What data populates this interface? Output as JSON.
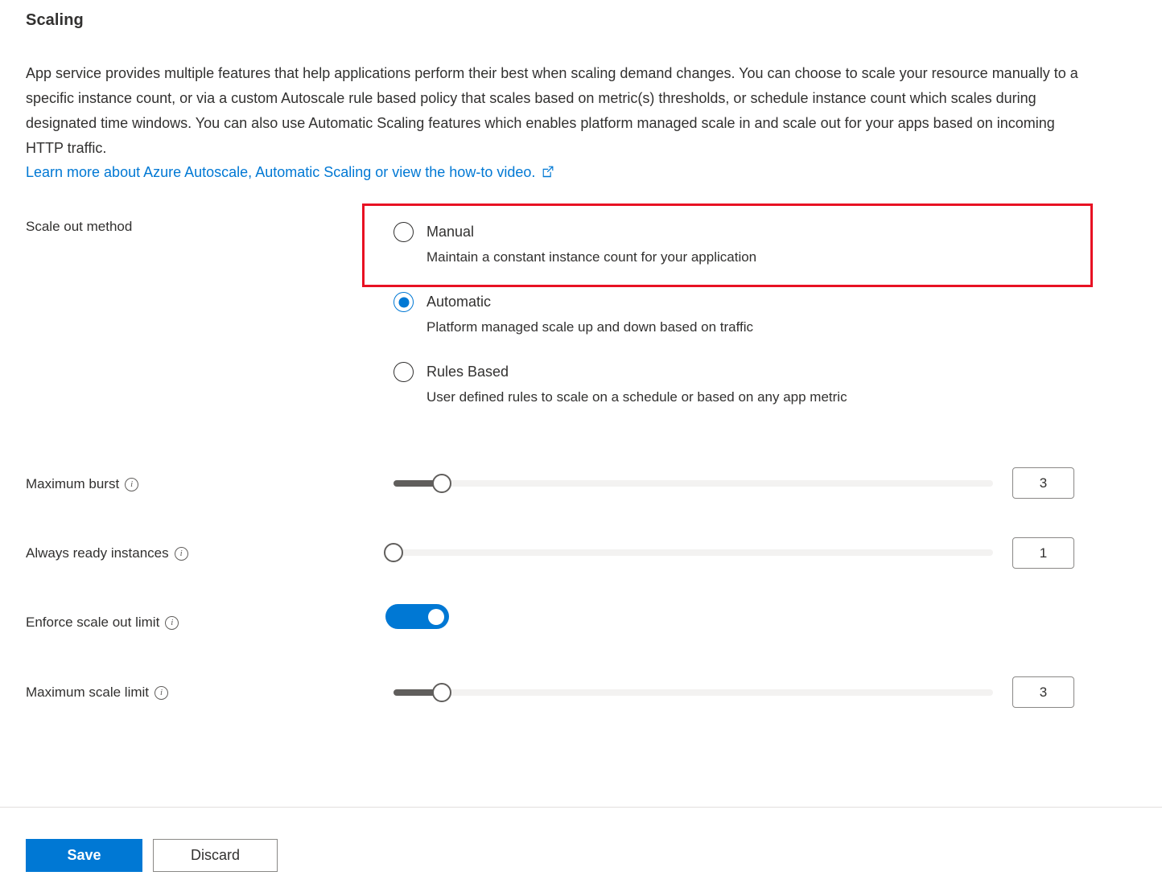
{
  "page": {
    "title": "Scaling",
    "description": "App service provides multiple features that help applications perform their best when scaling demand changes. You can choose to scale your resource manually to a specific instance count, or via a custom Autoscale rule based policy that scales based on metric(s) thresholds, or schedule instance count which scales during designated time windows. You can also use Automatic Scaling features which enables platform managed scale in and scale out for your apps based on incoming HTTP traffic.",
    "learn_more_text": "Learn more about Azure Autoscale, Automatic Scaling or view the how-to video.",
    "learn_more_icon": "external-link-icon"
  },
  "scale_out_method": {
    "label": "Scale out method",
    "selected": "Automatic",
    "options": [
      {
        "value": "Manual",
        "label": "Manual",
        "description": "Maintain a constant instance count for your application",
        "checked": false,
        "highlighted": true
      },
      {
        "value": "Automatic",
        "label": "Automatic",
        "description": "Platform managed scale up and down based on traffic",
        "checked": true,
        "highlighted": false
      },
      {
        "value": "RulesBased",
        "label": "Rules Based",
        "description": "User defined rules to scale on a schedule or based on any app metric",
        "checked": false,
        "highlighted": false
      }
    ]
  },
  "settings": {
    "maximum_burst": {
      "label": "Maximum burst",
      "info_icon": "info-icon",
      "value": "3",
      "slider_percent": 8
    },
    "always_ready_instances": {
      "label": "Always ready instances",
      "info_icon": "info-icon",
      "value": "1",
      "slider_percent": 0
    },
    "enforce_scale_out_limit": {
      "label": "Enforce scale out limit",
      "info_icon": "info-icon",
      "enabled": true
    },
    "maximum_scale_limit": {
      "label": "Maximum scale limit",
      "info_icon": "info-icon",
      "value": "3",
      "slider_percent": 8
    }
  },
  "footer": {
    "save_label": "Save",
    "discard_label": "Discard"
  },
  "colors": {
    "accent": "#0078d4",
    "highlight": "#e81123",
    "text": "#323130",
    "track": "#f3f2f1",
    "track_fill": "#605e5c"
  }
}
